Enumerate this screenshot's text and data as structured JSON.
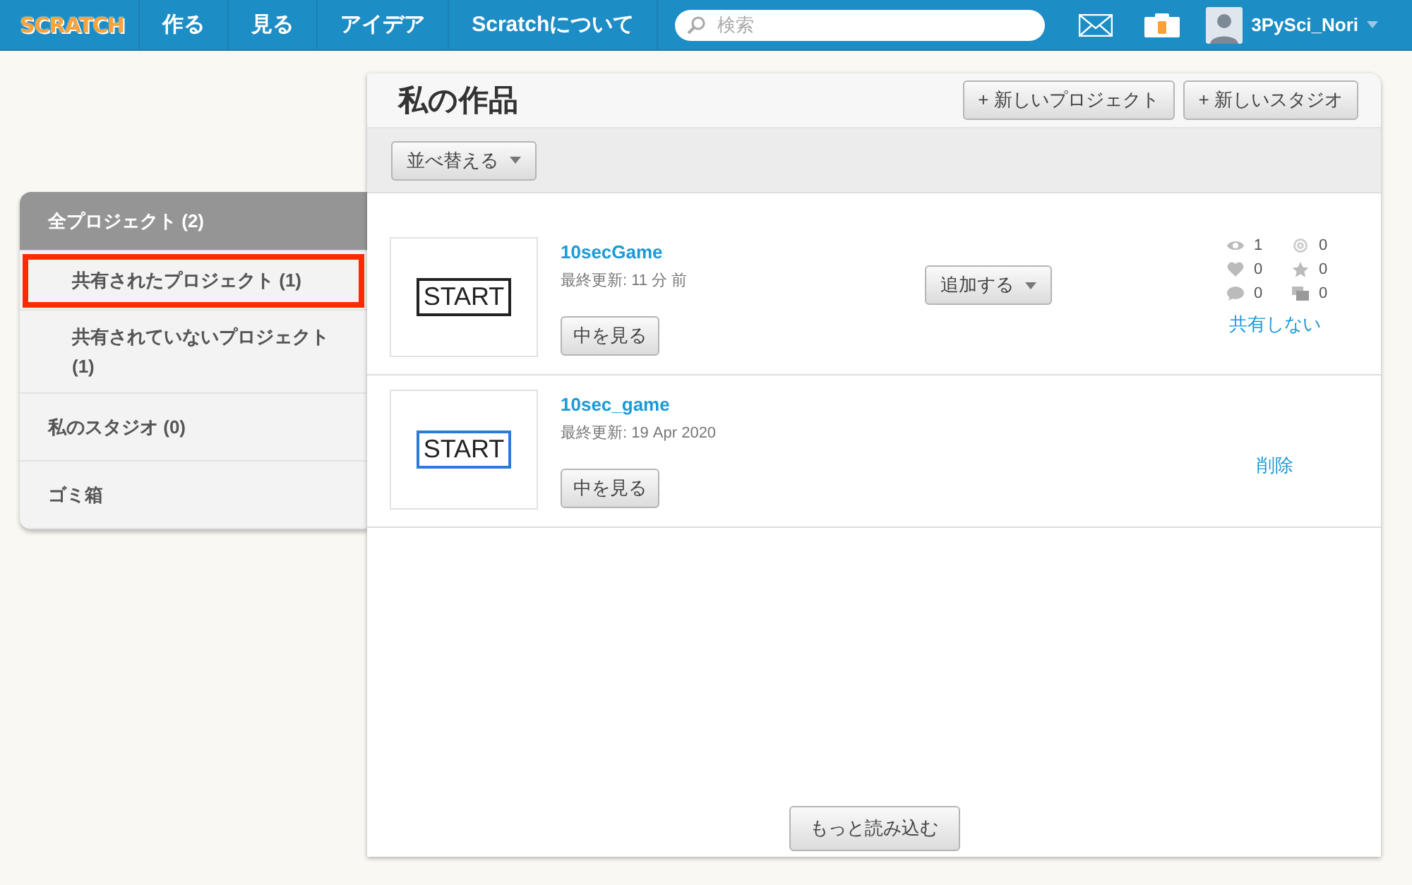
{
  "navbar": {
    "logo": "SCRATCH",
    "links": [
      "作る",
      "見る",
      "アイデア",
      "Scratchについて"
    ],
    "search": {
      "placeholder": "検索"
    },
    "username": "3PySci_Nori"
  },
  "sidebar": {
    "items": [
      {
        "label": "全プロジェクト (2)",
        "selected": true,
        "highlighted": false,
        "children": [
          {
            "label": "共有されたプロジェクト (1)",
            "selected": false,
            "highlighted": true
          },
          {
            "label": "共有されていないプロジェクト (1)",
            "selected": false,
            "highlighted": false
          }
        ]
      },
      {
        "label": "私のスタジオ (0)",
        "selected": false,
        "highlighted": false
      },
      {
        "label": "ゴミ箱",
        "selected": false,
        "highlighted": false
      }
    ]
  },
  "main": {
    "title": "私の作品",
    "new_buttons": [
      "+ 新しいプロジェクト",
      "+ 新しいスタジオ"
    ],
    "sort_button": "並べ替える",
    "projects": [
      {
        "kind": "shared",
        "title": "10secGame",
        "updated": "最終更新: 11 分 前",
        "thumbnail_text": "START",
        "color": "#222222",
        "view_button": "中を見る",
        "add_button": "追加する",
        "stats": {
          "views": "1",
          "remixes": "0",
          "loves": "0",
          "favorites": "0",
          "comments": "0",
          "studios": "0"
        },
        "action": "共有しない"
      },
      {
        "kind": "unshared",
        "title": "10sec_game",
        "updated": "最終更新: 19 Apr 2020",
        "thumbnail_text": "START",
        "color": "#2b7bd8",
        "view_button": "中を見る",
        "action": "削除"
      }
    ],
    "load_more": "もっと読み込む"
  }
}
